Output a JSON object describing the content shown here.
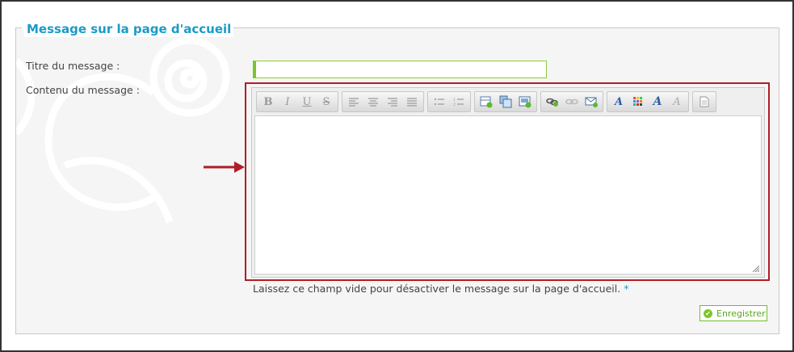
{
  "form": {
    "legend": "Message sur la page d'accueil",
    "title_label": "Titre du message :",
    "title_value": "",
    "content_label": "Contenu du message :",
    "hint": "Laissez ce champ vide pour désactiver le message sur la page d'accueil.",
    "required_marker": "*",
    "save_label": "Enregistrer"
  },
  "toolbar": {
    "groups": [
      [
        "bold-icon",
        "italic-icon",
        "underline-icon",
        "strikethrough-icon"
      ],
      [
        "align-left-icon",
        "align-center-icon",
        "align-right-icon",
        "align-justify-icon"
      ],
      [
        "bulleted-list-icon",
        "numbered-list-icon"
      ],
      [
        "insert-table-icon",
        "insert-image-icon",
        "insert-media-icon"
      ],
      [
        "insert-link-icon",
        "remove-link-icon",
        "insert-email-icon"
      ],
      [
        "text-format-icon",
        "color-picker-icon",
        "font-style-icon",
        "clear-format-icon"
      ],
      [
        "source-document-icon"
      ]
    ]
  },
  "colors": {
    "accent": "#1a9bc7",
    "highlight": "#b01e23",
    "success": "#7bc62a"
  }
}
